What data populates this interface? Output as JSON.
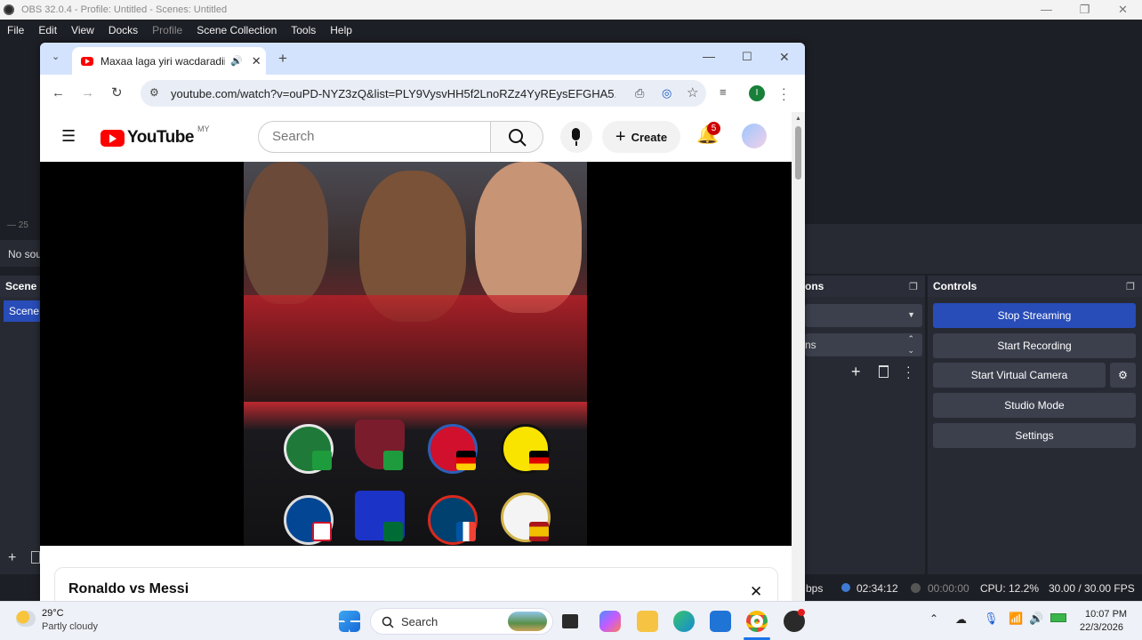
{
  "obs": {
    "title": "OBS 32.0.4 - Profile: Untitled - Scenes: Untitled",
    "window_controls": [
      "—",
      "❐",
      "✕"
    ],
    "menu": [
      {
        "label": "File",
        "enabled": true
      },
      {
        "label": "Edit",
        "enabled": true
      },
      {
        "label": "View",
        "enabled": true
      },
      {
        "label": "Docks",
        "enabled": true
      },
      {
        "label": "Profile",
        "enabled": false
      },
      {
        "label": "Scene Collection",
        "enabled": true
      },
      {
        "label": "Tools",
        "enabled": true
      },
      {
        "label": "Help",
        "enabled": true
      }
    ],
    "left_partial": {
      "no_source": "No sou",
      "scenes_header": "Scene",
      "scene_item": "Scene",
      "volume_tick": "— 25"
    },
    "sources_header_partial": "ons",
    "transitions_partial": "ns",
    "controls": {
      "header": "Controls",
      "stop_streaming": "Stop Streaming",
      "start_recording": "Start Recording",
      "start_virtual_camera": "Start Virtual Camera",
      "studio_mode": "Studio Mode",
      "settings": "Settings"
    },
    "status": {
      "kbps_partial": "bps",
      "stream_time": "02:34:12",
      "record_time": "00:00:00",
      "cpu": "CPU: 12.2%",
      "fps": "30.00 / 30.00 FPS"
    }
  },
  "chrome": {
    "tab_title": "Maxaa laga yiri wacdaradii",
    "url": "youtube.com/watch?v=ouPD-NYZ3zQ&list=PLY9VysvHH5f2LnoRZz4YyREysEFGHA5...",
    "profile_initial": "I",
    "youtube": {
      "logo_text": "YouTube",
      "region": "MY",
      "search_placeholder": "Search",
      "create_label": "Create",
      "notifications_count": "5",
      "video_card_title": "Ronaldo vs Messi"
    }
  },
  "taskbar": {
    "weather_temp": "29°C",
    "weather_desc": "Partly cloudy",
    "search_label": "Search",
    "time": "10:07 PM",
    "date": "22/3/2026"
  },
  "colors": {
    "obs_bg": "#1d1f26",
    "obs_accent": "#284cb8",
    "chrome_tabstrip": "#d3e3fd",
    "youtube_red": "#ff0000"
  }
}
